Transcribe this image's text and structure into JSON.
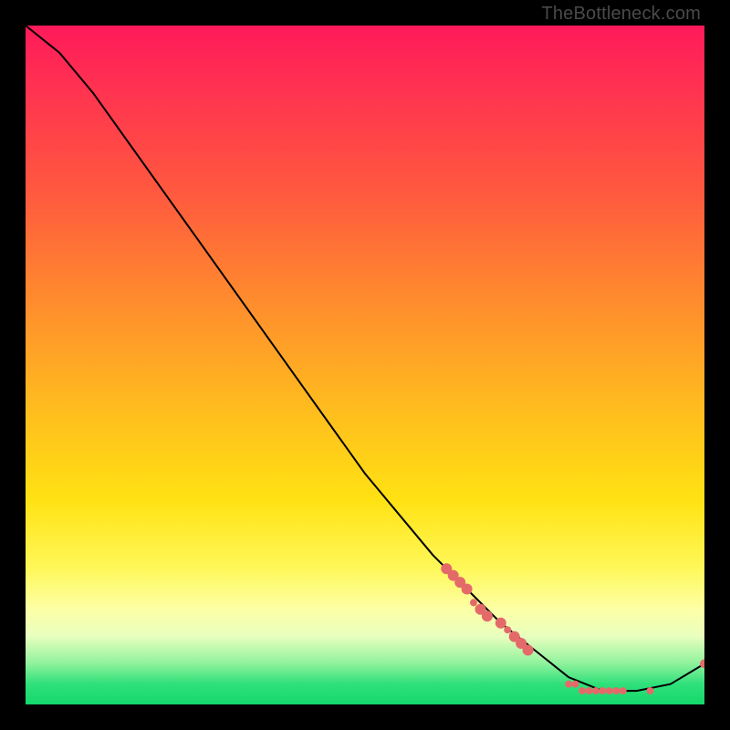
{
  "watermark": "TheBottleneck.com",
  "chart_data": {
    "type": "line",
    "title": "",
    "xlabel": "",
    "ylabel": "",
    "xlim": [
      0,
      100
    ],
    "ylim": [
      0,
      100
    ],
    "grid": false,
    "legend": false,
    "series": [
      {
        "name": "bottleneck-curve",
        "color": "#000000",
        "x": [
          0,
          5,
          10,
          15,
          20,
          25,
          30,
          35,
          40,
          45,
          50,
          55,
          60,
          65,
          70,
          75,
          80,
          85,
          90,
          95,
          100
        ],
        "y": [
          100,
          96,
          90,
          83,
          76,
          69,
          62,
          55,
          48,
          41,
          34,
          28,
          22,
          17,
          12,
          8,
          4,
          2,
          2,
          3,
          6
        ]
      }
    ],
    "markers": {
      "name": "highlighted-points",
      "color": "#e46a6a",
      "radius_small": 4,
      "radius_large": 6,
      "points": [
        {
          "x": 62,
          "y": 20,
          "r": 6
        },
        {
          "x": 63,
          "y": 19,
          "r": 6
        },
        {
          "x": 64,
          "y": 18,
          "r": 6
        },
        {
          "x": 65,
          "y": 17,
          "r": 6
        },
        {
          "x": 66,
          "y": 15,
          "r": 4
        },
        {
          "x": 67,
          "y": 14,
          "r": 6
        },
        {
          "x": 68,
          "y": 13,
          "r": 6
        },
        {
          "x": 70,
          "y": 12,
          "r": 6
        },
        {
          "x": 71,
          "y": 11,
          "r": 4
        },
        {
          "x": 72,
          "y": 10,
          "r": 6
        },
        {
          "x": 73,
          "y": 9,
          "r": 6
        },
        {
          "x": 74,
          "y": 8,
          "r": 6
        },
        {
          "x": 80,
          "y": 3,
          "r": 4
        },
        {
          "x": 81,
          "y": 3,
          "r": 4
        },
        {
          "x": 82,
          "y": 2,
          "r": 4
        },
        {
          "x": 83,
          "y": 2,
          "r": 4
        },
        {
          "x": 84,
          "y": 2,
          "r": 4
        },
        {
          "x": 85,
          "y": 2,
          "r": 4
        },
        {
          "x": 86,
          "y": 2,
          "r": 4
        },
        {
          "x": 87,
          "y": 2,
          "r": 4
        },
        {
          "x": 88,
          "y": 2,
          "r": 4
        },
        {
          "x": 92,
          "y": 2,
          "r": 4
        },
        {
          "x": 100,
          "y": 6,
          "r": 5
        }
      ]
    },
    "background": {
      "type": "vertical-gradient",
      "stops": [
        {
          "pos": 0.0,
          "color": "#ff1a5a"
        },
        {
          "pos": 0.25,
          "color": "#ff5a3e"
        },
        {
          "pos": 0.55,
          "color": "#ffb81f"
        },
        {
          "pos": 0.8,
          "color": "#fff85a"
        },
        {
          "pos": 0.94,
          "color": "#8ef29c"
        },
        {
          "pos": 1.0,
          "color": "#14d86b"
        }
      ]
    }
  }
}
